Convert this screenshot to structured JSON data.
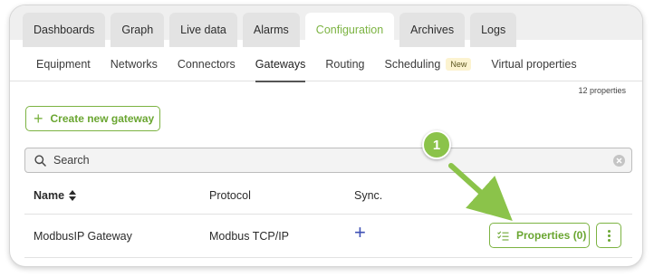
{
  "nav": {
    "main_tabs": [
      {
        "label": "Dashboards"
      },
      {
        "label": "Graph"
      },
      {
        "label": "Live data"
      },
      {
        "label": "Alarms"
      },
      {
        "label": "Configuration",
        "active": true
      },
      {
        "label": "Archives"
      },
      {
        "label": "Logs"
      }
    ],
    "sub_tabs": [
      {
        "label": "Equipment"
      },
      {
        "label": "Networks"
      },
      {
        "label": "Connectors"
      },
      {
        "label": "Gateways",
        "active": true
      },
      {
        "label": "Routing"
      },
      {
        "label": "Scheduling",
        "badge": "New"
      },
      {
        "label": "Virtual properties"
      }
    ]
  },
  "content": {
    "count_text": "12 properties",
    "create_button": {
      "label": "Create new gateway",
      "icon": "plus-icon"
    },
    "search": {
      "placeholder": "Search",
      "value": ""
    },
    "table": {
      "columns": [
        {
          "label": "Name",
          "sortable": true
        },
        {
          "label": "Protocol"
        },
        {
          "label": "Sync."
        }
      ],
      "rows": [
        {
          "name": "ModbusIP Gateway",
          "protocol": "Modbus TCP/IP",
          "sync_icon": "plus-icon",
          "properties_button": "Properties (0)"
        }
      ]
    }
  },
  "callout": {
    "number": "1"
  },
  "colors": {
    "accent_green": "#7cb342",
    "accent_green_text": "#6aa631",
    "sync_blue": "#3f51b5",
    "badge_bg": "#fcf3d0"
  }
}
